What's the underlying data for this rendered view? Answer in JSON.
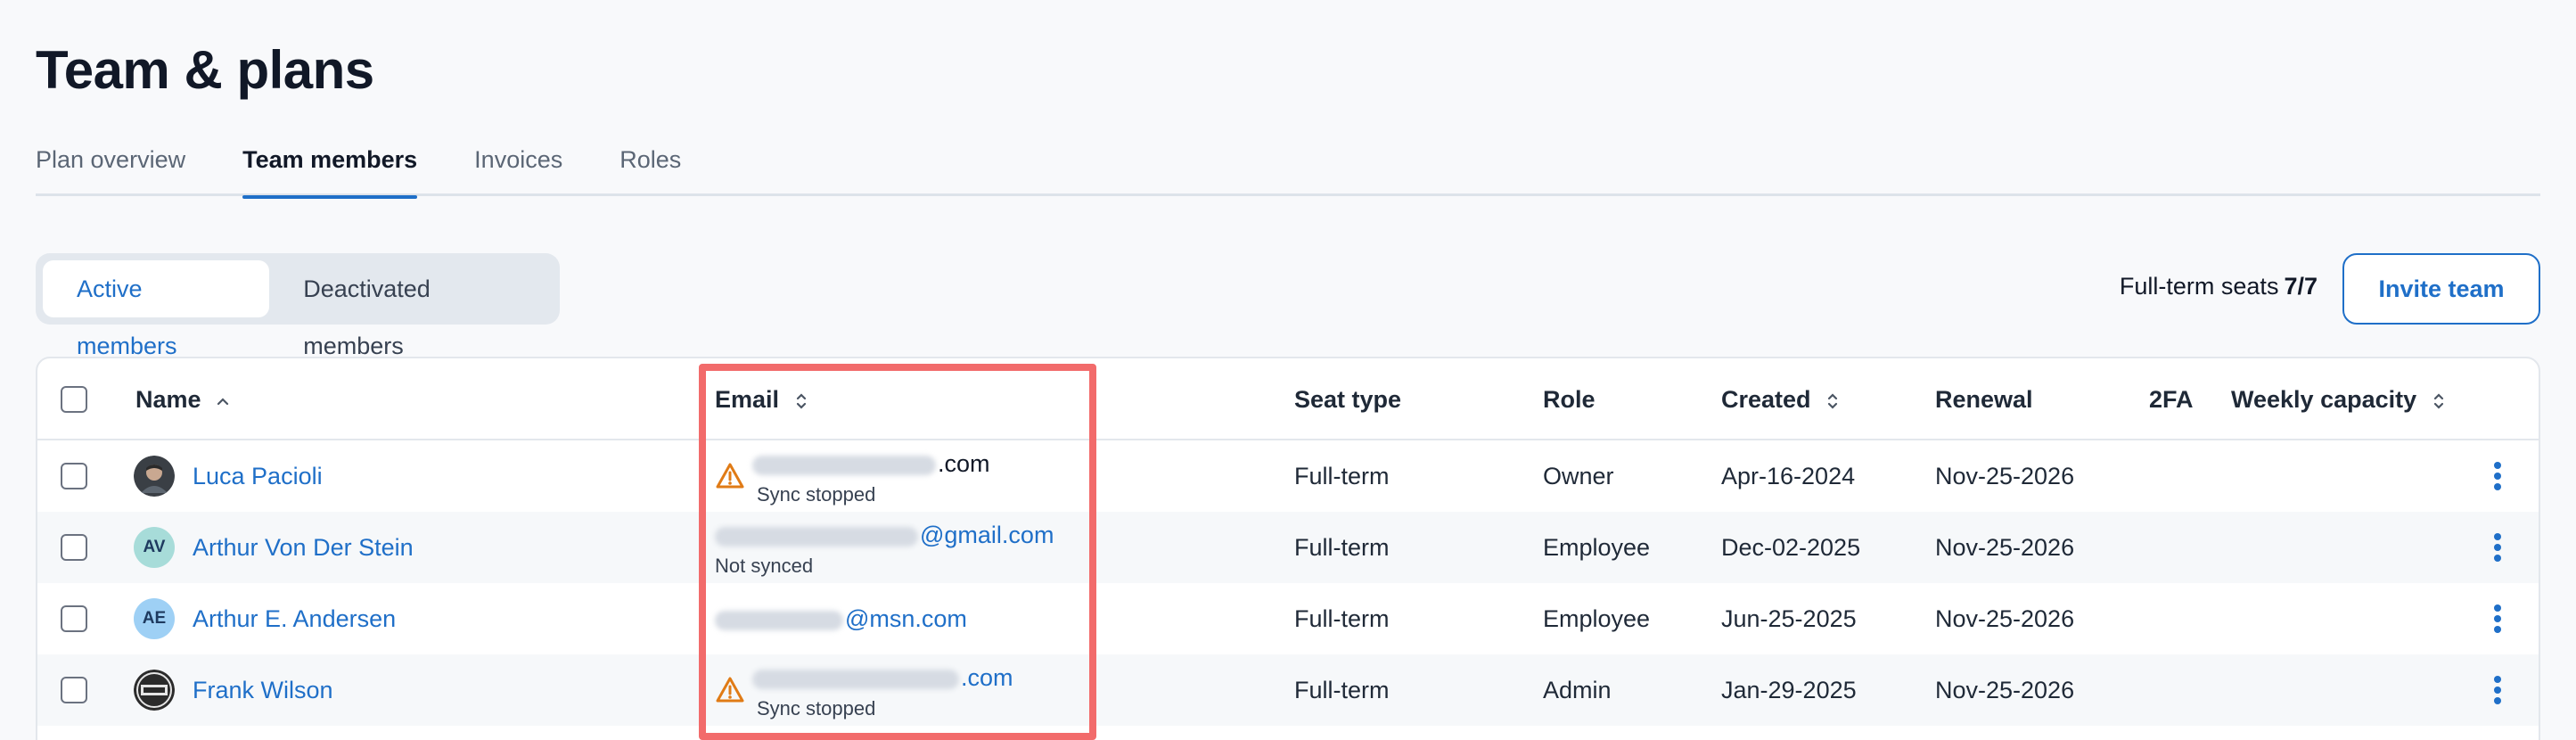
{
  "page": {
    "title": "Team & plans"
  },
  "tabs": [
    {
      "label": "Plan overview",
      "active": false
    },
    {
      "label": "Team members",
      "active": true
    },
    {
      "label": "Invoices",
      "active": false
    },
    {
      "label": "Roles",
      "active": false
    }
  ],
  "segments": {
    "active_label": "Active members",
    "deactivated_label": "Deactivated members"
  },
  "seats": {
    "label": "Full-term seats",
    "value": "7/7"
  },
  "invite": {
    "label": "Invite team"
  },
  "columns": {
    "name": "Name",
    "email": "Email",
    "seat_type": "Seat type",
    "role": "Role",
    "created": "Created",
    "renewal": "Renewal",
    "twofa": "2FA",
    "capacity": "Weekly capacity"
  },
  "rows": [
    {
      "name": "Luca Pacioli",
      "avatar": "photo",
      "email_visible": ".com",
      "email_color": "#111827",
      "email_status": "Sync stopped",
      "warning": true,
      "seat_type": "Full-term",
      "role": "Owner",
      "created": "Apr-16-2024",
      "renewal": "Nov-25-2026"
    },
    {
      "name": "Arthur Von Der Stein",
      "avatar_initials": "AV",
      "avatar_color": "#a7dcd9",
      "email_visible": "@gmail.com",
      "email_color": "#1f6fc8",
      "email_status": "Not synced",
      "warning": false,
      "seat_type": "Full-term",
      "role": "Employee",
      "created": "Dec-02-2025",
      "renewal": "Nov-25-2026"
    },
    {
      "name": "Arthur E. Andersen",
      "avatar_initials": "AE",
      "avatar_color": "#9ed0f5",
      "email_visible": "@msn.com",
      "email_color": "#1f6fc8",
      "email_status": "",
      "warning": false,
      "seat_type": "Full-term",
      "role": "Employee",
      "created": "Jun-25-2025",
      "renewal": "Nov-25-2026"
    },
    {
      "name": "Frank Wilson",
      "avatar": "badge",
      "email_visible": ".com",
      "email_color": "#1f6fc8",
      "email_status": "Sync stopped",
      "warning": true,
      "seat_type": "Full-term",
      "role": "Admin",
      "created": "Jan-29-2025",
      "renewal": "Nov-25-2026"
    }
  ],
  "colors": {
    "accent": "#1f6fc8",
    "warning": "#e07b16",
    "highlight": "#f26b6b"
  }
}
